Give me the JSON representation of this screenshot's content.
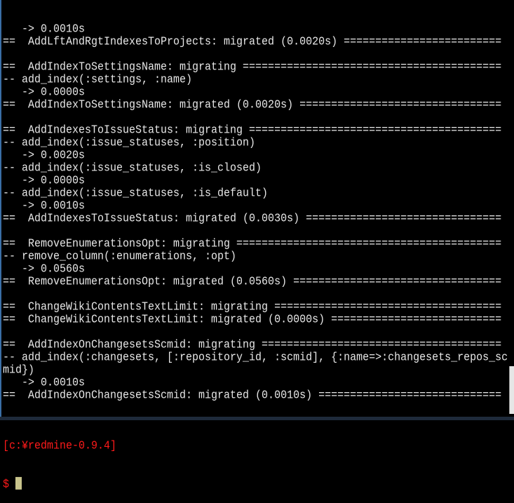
{
  "terminal": {
    "lines": [
      "   -> 0.0010s",
      "==  AddLftAndRgtIndexesToProjects: migrated (0.0020s) =========================",
      "",
      "==  AddIndexToSettingsName: migrating =========================================",
      "-- add_index(:settings, :name)",
      "   -> 0.0000s",
      "==  AddIndexToSettingsName: migrated (0.0020s) ================================",
      "",
      "==  AddIndexesToIssueStatus: migrating ========================================",
      "-- add_index(:issue_statuses, :position)",
      "   -> 0.0020s",
      "-- add_index(:issue_statuses, :is_closed)",
      "   -> 0.0000s",
      "-- add_index(:issue_statuses, :is_default)",
      "   -> 0.0010s",
      "==  AddIndexesToIssueStatus: migrated (0.0030s) ===============================",
      "",
      "==  RemoveEnumerationsOpt: migrating ==========================================",
      "-- remove_column(:enumerations, :opt)",
      "   -> 0.0560s",
      "==  RemoveEnumerationsOpt: migrated (0.0560s) =================================",
      "",
      "==  ChangeWikiContentsTextLimit: migrating ====================================",
      "==  ChangeWikiContentsTextLimit: migrated (0.0000s) ===========================",
      "",
      "==  AddIndexOnChangesetsScmid: migrating ======================================",
      "-- add_index(:changesets, [:repository_id, :scmid], {:name=>:changesets_repos_sc",
      "mid})",
      "   -> 0.0010s",
      "==  AddIndexOnChangesetsScmid: migrated (0.0010s) =============================",
      ""
    ],
    "prompt_path": "[c:¥redmine-0.9.4]",
    "prompt_symbol": "$",
    "colors": {
      "text": "#e8e8e8",
      "prompt": "#ff1a1a",
      "cursor": "#c8c48c",
      "background": "#000000"
    }
  }
}
